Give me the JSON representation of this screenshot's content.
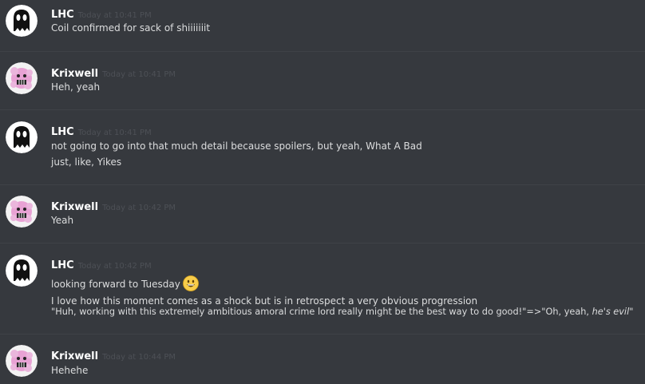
{
  "colors": {
    "background": "#36393e",
    "username": "#ffffff",
    "timestamp": "#4d5056",
    "message_text": "#dcddde",
    "divider": "#3f4247"
  },
  "messages": [
    {
      "username": "LHC",
      "timestamp": "Today at 10:41 PM",
      "avatar": "ghost-avatar",
      "lines": [
        "Coil confirmed for sack of shiiiiiiit"
      ]
    },
    {
      "username": "Krixwell",
      "timestamp": "Today at 10:41 PM",
      "avatar": "pink-creature-avatar",
      "lines": [
        "Heh, yeah"
      ]
    },
    {
      "username": "LHC",
      "timestamp": "Today at 10:41 PM",
      "avatar": "ghost-avatar",
      "lines": [
        "not going to go into that much detail because spoilers, but yeah, What A Bad",
        "just, like, Yikes"
      ]
    },
    {
      "username": "Krixwell",
      "timestamp": "Today at 10:42 PM",
      "avatar": "pink-creature-avatar",
      "lines": [
        "Yeah"
      ]
    },
    {
      "username": "LHC",
      "timestamp": "Today at 10:42 PM",
      "avatar": "ghost-avatar",
      "lines": [
        "looking forward to Tuesday",
        "I love how this moment comes as a shock but is in retrospect a very obvious progression",
        "\"Huh, working with this extremely ambitious amoral crime lord really might be the best way to do good!\"=>\"Oh, yeah, ",
        "he's evil",
        "\""
      ],
      "emoji": "grinning-face-emoji"
    },
    {
      "username": "Krixwell",
      "timestamp": "Today at 10:44 PM",
      "avatar": "pink-creature-avatar",
      "lines": [
        "Hehehe"
      ]
    }
  ]
}
